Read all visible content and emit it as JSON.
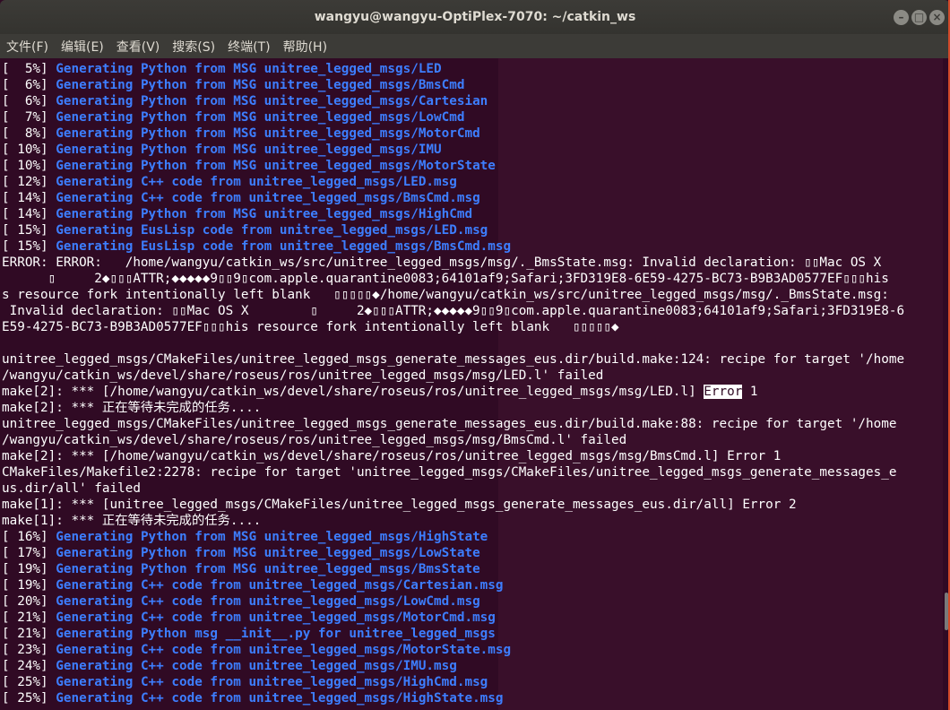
{
  "window": {
    "title": "wangyu@wangyu-OptiPlex-7070: ~/catkin_ws",
    "controls": {
      "close": "×",
      "minimize": "–",
      "maximize": "□"
    }
  },
  "menu": [
    "文件(F)",
    "编辑(E)",
    "查看(V)",
    "搜索(S)",
    "终端(T)",
    "帮助(H)"
  ],
  "terminal": {
    "progress_top": [
      {
        "pct": "[  5%]",
        "text": " Generating Python from MSG unitree_legged_msgs/LED"
      },
      {
        "pct": "[  6%]",
        "text": " Generating Python from MSG unitree_legged_msgs/BmsCmd"
      },
      {
        "pct": "[  6%]",
        "text": " Generating Python from MSG unitree_legged_msgs/Cartesian"
      },
      {
        "pct": "[  7%]",
        "text": " Generating Python from MSG unitree_legged_msgs/LowCmd"
      },
      {
        "pct": "[  8%]",
        "text": " Generating Python from MSG unitree_legged_msgs/MotorCmd"
      },
      {
        "pct": "[ 10%]",
        "text": " Generating Python from MSG unitree_legged_msgs/IMU"
      },
      {
        "pct": "[ 10%]",
        "text": " Generating Python from MSG unitree_legged_msgs/MotorState"
      },
      {
        "pct": "[ 12%]",
        "text": " Generating C++ code from unitree_legged_msgs/LED.msg"
      },
      {
        "pct": "[ 14%]",
        "text": " Generating C++ code from unitree_legged_msgs/BmsCmd.msg"
      },
      {
        "pct": "[ 14%]",
        "text": " Generating Python from MSG unitree_legged_msgs/HighCmd"
      },
      {
        "pct": "[ 15%]",
        "text": " Generating EusLisp code from unitree_legged_msgs/LED.msg"
      },
      {
        "pct": "[ 15%]",
        "text": " Generating EusLisp code from unitree_legged_msgs/BmsCmd.msg"
      }
    ],
    "error_lines": [
      "ERROR: ERROR:   /home/wangyu/catkin_ws/src/unitree_legged_msgs/msg/._BmsState.msg: Invalid declaration: ▯▯Mac OS X",
      "      ▯     2◆▯▯▯ATTR;◆◆◆◆◆9▯▯9▯com.apple.quarantine0083;64101af9;Safari;3FD319E8-6E59-4275-BC73-B9B3AD0577EF▯▯▯his",
      "s resource fork intentionally left blank   ▯▯▯▯▯◆/home/wangyu/catkin_ws/src/unitree_legged_msgs/msg/._BmsState.msg:",
      " Invalid declaration: ▯▯Mac OS X        ▯     2◆▯▯▯ATTR;◆◆◆◆◆9▯▯9▯com.apple.quarantine0083;64101af9;Safari;3FD319E8-6",
      "E59-4275-BC73-B9B3AD0577EF▯▯▯his resource fork intentionally left blank   ▯▯▯▯▯◆",
      "",
      "unitree_legged_msgs/CMakeFiles/unitree_legged_msgs_generate_messages_eus.dir/build.make:124: recipe for target '/home",
      "/wangyu/catkin_ws/devel/share/roseus/ros/unitree_legged_msgs/msg/LED.l' failed"
    ],
    "make_led_prefix": "make[2]: *** [/home/wangyu/catkin_ws/devel/share/roseus/ros/unitree_legged_msgs/msg/LED.l] ",
    "make_led_error": "Error",
    "make_led_suffix": " 1",
    "more_lines": [
      "make[2]: *** 正在等待未完成的任务....",
      "unitree_legged_msgs/CMakeFiles/unitree_legged_msgs_generate_messages_eus.dir/build.make:88: recipe for target '/home",
      "/wangyu/catkin_ws/devel/share/roseus/ros/unitree_legged_msgs/msg/BmsCmd.l' failed",
      "make[2]: *** [/home/wangyu/catkin_ws/devel/share/roseus/ros/unitree_legged_msgs/msg/BmsCmd.l] Error 1",
      "CMakeFiles/Makefile2:2278: recipe for target 'unitree_legged_msgs/CMakeFiles/unitree_legged_msgs_generate_messages_e",
      "us.dir/all' failed",
      "make[1]: *** [unitree_legged_msgs/CMakeFiles/unitree_legged_msgs_generate_messages_eus.dir/all] Error 2",
      "make[1]: *** 正在等待未完成的任务...."
    ],
    "progress_bottom": [
      {
        "pct": "[ 16%]",
        "text": " Generating Python from MSG unitree_legged_msgs/HighState"
      },
      {
        "pct": "[ 17%]",
        "text": " Generating Python from MSG unitree_legged_msgs/LowState"
      },
      {
        "pct": "[ 19%]",
        "text": " Generating Python from MSG unitree_legged_msgs/BmsState"
      },
      {
        "pct": "[ 19%]",
        "text": " Generating C++ code from unitree_legged_msgs/Cartesian.msg"
      },
      {
        "pct": "[ 20%]",
        "text": " Generating C++ code from unitree_legged_msgs/LowCmd.msg"
      },
      {
        "pct": "[ 21%]",
        "text": " Generating C++ code from unitree_legged_msgs/MotorCmd.msg"
      },
      {
        "pct": "[ 21%]",
        "text": " Generating Python msg __init__.py for unitree_legged_msgs"
      },
      {
        "pct": "[ 23%]",
        "text": " Generating C++ code from unitree_legged_msgs/MotorState.msg"
      },
      {
        "pct": "[ 24%]",
        "text": " Generating C++ code from unitree_legged_msgs/IMU.msg"
      },
      {
        "pct": "[ 25%]",
        "text": " Generating C++ code from unitree_legged_msgs/HighCmd.msg"
      },
      {
        "pct": "[ 25%]",
        "text": " Generating C++ code from unitree_legged_msgs/HighState.msg"
      }
    ]
  },
  "colors": {
    "terminal_bg": "#300a24",
    "generating_text": "#3d7eff",
    "titlebar": "#3c3b37"
  }
}
